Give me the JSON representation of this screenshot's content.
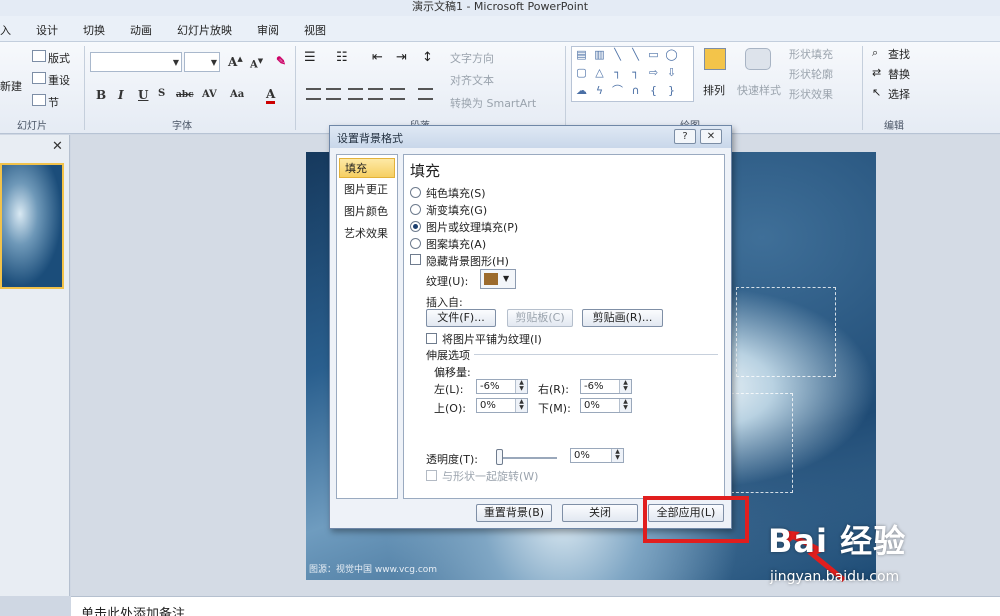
{
  "window": {
    "title": "演示文稿1 - Microsoft PowerPoint"
  },
  "menu": {
    "tabs": [
      "入",
      "设计",
      "切换",
      "动画",
      "幻灯片放映",
      "审阅",
      "视图"
    ]
  },
  "ribbon": {
    "slides_group": {
      "label": "幻灯片",
      "new_slide": "新建",
      "layout": "版式",
      "reset": "重设",
      "section": "节"
    },
    "font_group": {
      "label": "字体"
    },
    "paragraph_group": {
      "label": "段落",
      "text_direction": "文字方向",
      "align_text": "对齐文本",
      "smartart": "转换为 SmartArt"
    },
    "drawing_group": {
      "label": "绘图",
      "arrange": "排列",
      "quick_styles": "快速样式",
      "shape_fill": "形状填充",
      "shape_outline": "形状轮廓",
      "shape_effects": "形状效果"
    },
    "editing_group": {
      "label": "编辑",
      "find": "查找",
      "replace": "替换",
      "select": "选择"
    }
  },
  "notes": {
    "placeholder": "单击此处添加备注"
  },
  "slide": {
    "credit": "图源：视觉中国 www.vcg.com"
  },
  "dialog": {
    "title": "设置背景格式",
    "help_button": "?",
    "close_button": "✕",
    "nav": [
      "填充",
      "图片更正",
      "图片颜色",
      "艺术效果"
    ],
    "panel_title": "填充",
    "fill_options": [
      "纯色填充(S)",
      "渐变填充(G)",
      "图片或纹理填充(P)",
      "图案填充(A)"
    ],
    "selected_fill": "图片或纹理填充(P)",
    "hide_background_graphics": "隐藏背景图形(H)",
    "texture_label": "纹理(U):",
    "insert_from": "插入自:",
    "file_button": "文件(F)...",
    "clipboard_button": "剪贴板(C)",
    "clipart_button": "剪贴画(R)...",
    "tile_as_texture": "将图片平铺为纹理(I)",
    "stretch_options": "伸展选项",
    "offsets": "偏移量:",
    "left_label": "左(L):",
    "left_value": "-6%",
    "right_label": "右(R):",
    "right_value": "-6%",
    "top_label": "上(O):",
    "top_value": "0%",
    "bottom_label": "下(M):",
    "bottom_value": "0%",
    "transparency_label": "透明度(T):",
    "transparency_value": "0%",
    "transparency": 0,
    "rotate_with_shape": "与形状一起旋转(W)",
    "reset_button": "重置背景(B)",
    "close_action": "关闭",
    "apply_all": "全部应用(L)"
  },
  "watermark": {
    "brand": "Bai 经验",
    "url": "jingyan.baidu.com"
  },
  "colors": {
    "highlight": "#e11e1e",
    "active_nav": "#f6cf62"
  }
}
